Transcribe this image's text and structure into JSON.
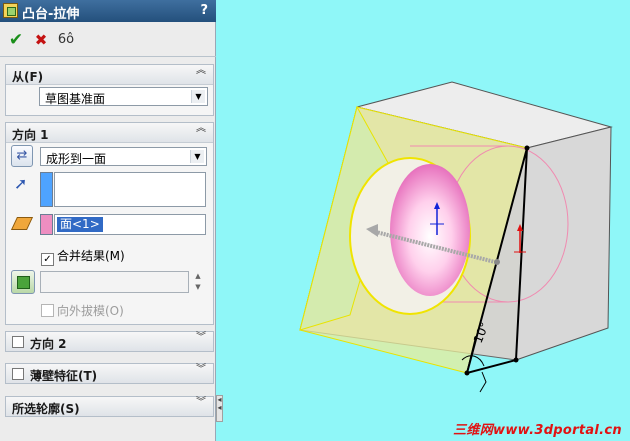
{
  "window": {
    "title": "凸台-拉伸",
    "help": "?"
  },
  "toolbar": {
    "ok": "✔",
    "cancel": "✖",
    "preview": "6ô"
  },
  "from": {
    "title": "从(F)",
    "value": "草图基准面"
  },
  "direction1": {
    "title": "方向 1",
    "end_condition": "成形到一面",
    "face": "面<1>",
    "merge_label": "合并结果(M)",
    "merge_checked": "✓",
    "draft_label": "向外拔模(O)"
  },
  "direction2": {
    "title": "方向 2"
  },
  "thin": {
    "title": "薄壁特征(T)"
  },
  "contours": {
    "title": "所选轮廓(S)"
  },
  "viewport": {
    "annotation": "10°",
    "watermark": "三维网www.3dportal.cn"
  },
  "colors": {
    "background": "#8ff7f8",
    "title_bar": "#2e5b89",
    "face_highlight": "#ee8ec1"
  }
}
